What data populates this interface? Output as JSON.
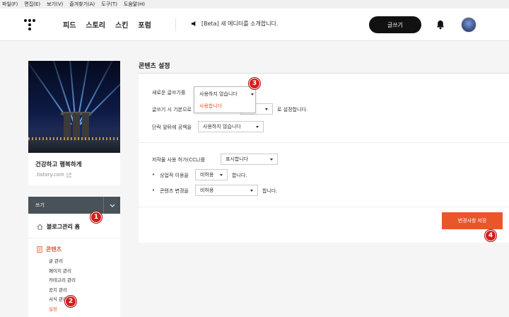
{
  "menubar": {
    "items": [
      "파일(F)",
      "편집(E)",
      "보기(V)",
      "즐겨찾기(A)",
      "도구(T)",
      "도움말(H)"
    ]
  },
  "nav": {
    "items": [
      "피드",
      "스토리",
      "스킨",
      "포럼"
    ],
    "notice": "[Beta] 새 에디터를 소개합니다.",
    "write_label": "글쓰기"
  },
  "blog": {
    "title": "건강하고 행복하게",
    "url": ".tistory.com"
  },
  "sidebar": {
    "write_label": "쓰기",
    "home_label": "블로그관리 홈",
    "content_label": "콘텐츠",
    "sub_items": [
      "글 관리",
      "페이지 관리",
      "카테고리 관리",
      "공지 관리",
      "서식 관리",
      "설정"
    ],
    "active_sub": "설정"
  },
  "settings": {
    "title": "콘텐츠 설정",
    "new_post_label": "새로운 글쓰기를",
    "new_post_value": "사용하지 않습니다",
    "default_label": "글쓰기 시 기본으로",
    "default_value": "비",
    "default_suffix": "로 설정합니다.",
    "paragraph_label": "단락 앞뒤에 공백을",
    "paragraph_value": "사용하지 않습니다",
    "ccl_label": "저작물 사용 허가(CCL)를",
    "ccl_value": "표시합니다",
    "commercial_label": "상업적 이용을",
    "commercial_value": "비허용",
    "commercial_suffix": "합니다.",
    "modify_label": "콘텐츠 변경을",
    "modify_value": "비허용",
    "modify_suffix": "합니다.",
    "bullet": "•",
    "dropdown_options": [
      "사용하지 않습니다",
      "사용합니다"
    ],
    "save_label": "변경사항 저장"
  },
  "markers": [
    "1",
    "2",
    "3",
    "4"
  ],
  "colors": {
    "accent": "#e8562a",
    "marker": "#d61d1d",
    "sidebar_bar": "#495259"
  }
}
